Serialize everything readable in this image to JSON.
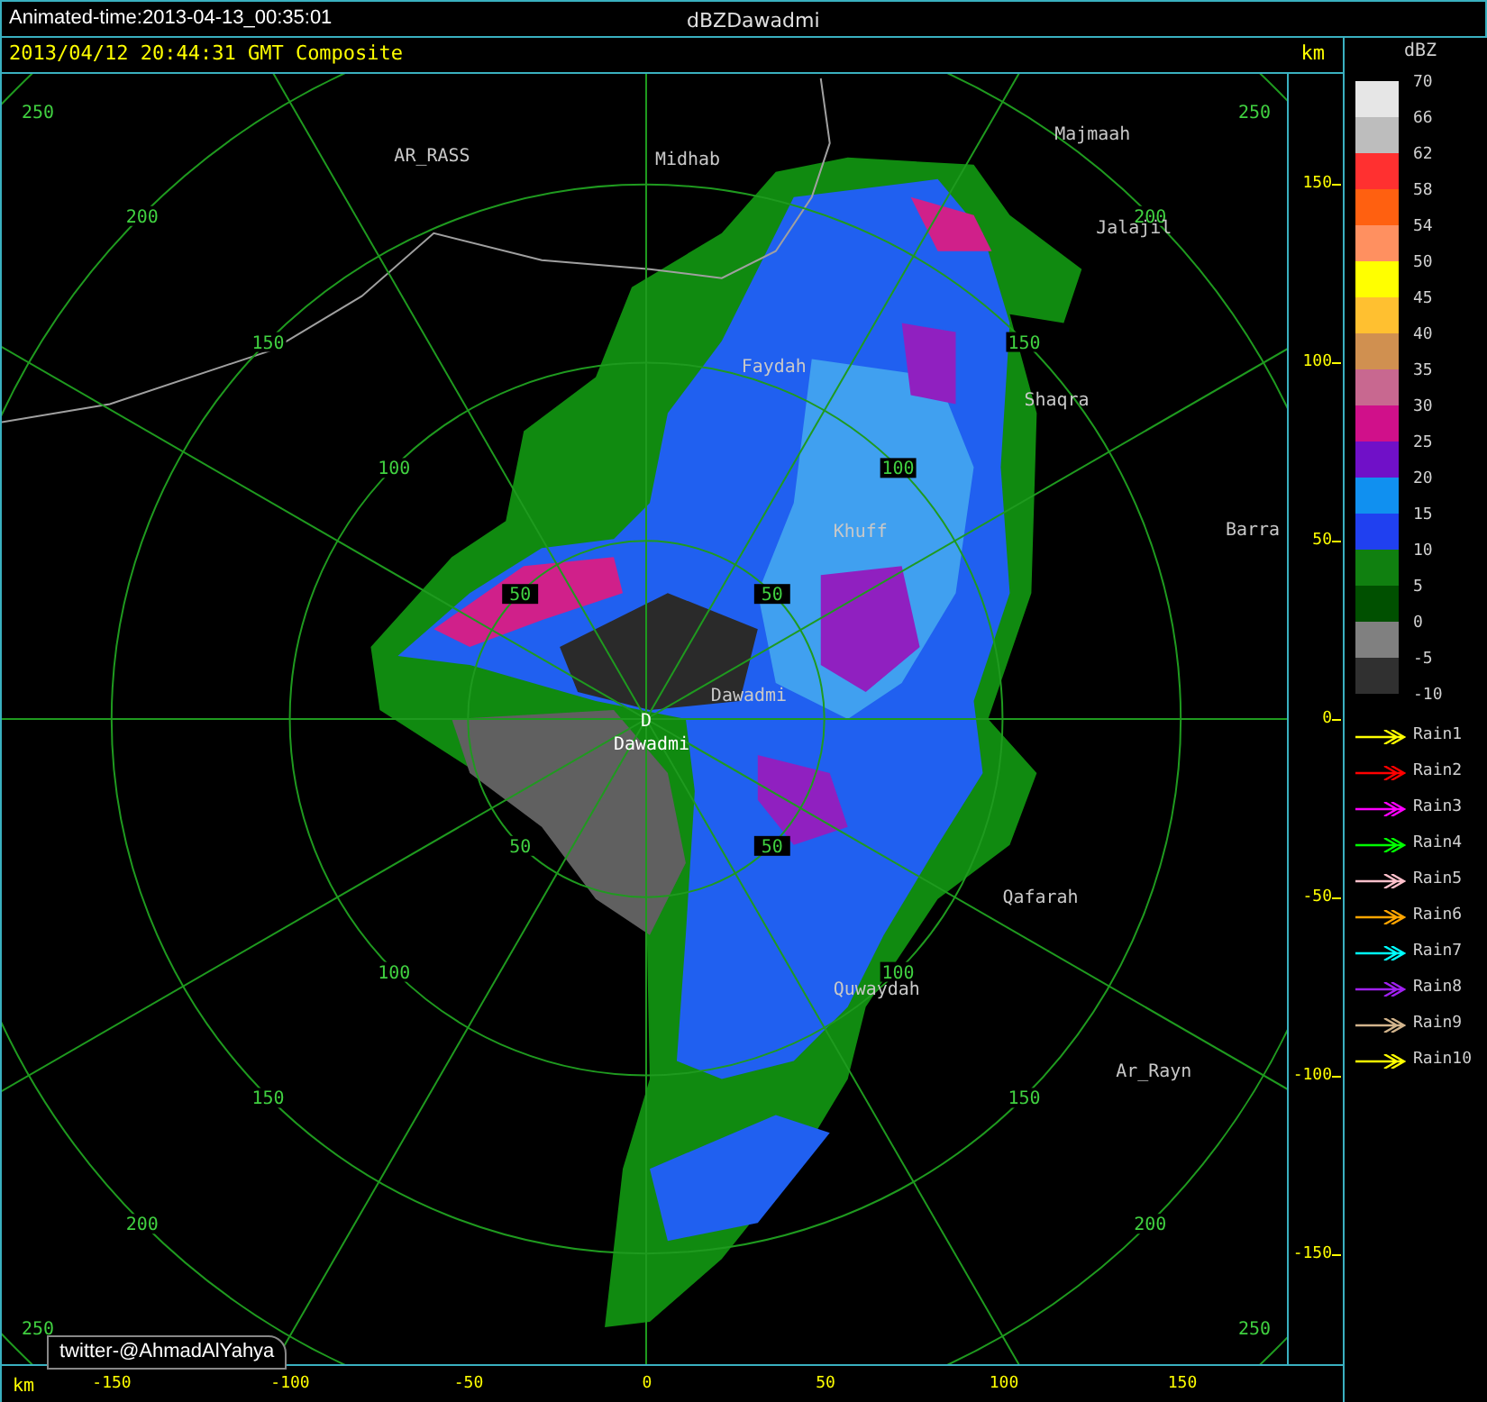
{
  "title_bar": {
    "animated_time": "Animated-time:2013-04-13_00:35:01",
    "product": "dBZDawadmi"
  },
  "header": {
    "timestamp": "2013/04/12 20:44:31 GMT Composite",
    "unit": "km"
  },
  "map": {
    "place_labels": [
      {
        "text": "AR_RASS",
        "kind": "city"
      },
      {
        "text": "Midhab",
        "kind": "city"
      },
      {
        "text": "Majmaah",
        "kind": "city"
      },
      {
        "text": "Jalajil",
        "kind": "city"
      },
      {
        "text": "Faydah",
        "kind": "city"
      },
      {
        "text": "Shaqra",
        "kind": "city"
      },
      {
        "text": "Khuff",
        "kind": "city"
      },
      {
        "text": "Barra",
        "kind": "city"
      },
      {
        "text": "Dawadmi",
        "kind": "city"
      },
      {
        "text": "D",
        "kind": "radar"
      },
      {
        "text": "Dawadmi",
        "kind": "radar"
      },
      {
        "text": "Qafarah",
        "kind": "city"
      },
      {
        "text": "Quwaydah",
        "kind": "city"
      },
      {
        "text": "Ar_Rayn",
        "kind": "city"
      }
    ],
    "ring_labels": [
      "50",
      "50",
      "50",
      "50",
      "100",
      "100",
      "100",
      "100",
      "150",
      "150",
      "150",
      "150",
      "200",
      "200",
      "200",
      "200",
      "250",
      "250",
      "250",
      "250"
    ],
    "credit": "twitter-@AhmadAlYahya"
  },
  "x_axis": {
    "unit": "km",
    "ticks": [
      "-150",
      "-100",
      "-50",
      "0",
      "50",
      "100",
      "150"
    ]
  },
  "y_axis": {
    "ticks": [
      "150",
      "100",
      "50",
      "0",
      "-50",
      "-100",
      "-150"
    ]
  },
  "legend": {
    "unit": "dBZ",
    "labels": [
      "70",
      "66",
      "62",
      "58",
      "54",
      "50",
      "45",
      "40",
      "35",
      "30",
      "25",
      "20",
      "15",
      "10",
      "5",
      "0",
      "-5",
      "-10"
    ],
    "swatches": [
      {
        "color": "#e6e6e6"
      },
      {
        "color": "#bdbdbd"
      },
      {
        "color": "#ff3030"
      },
      {
        "color": "#ff6010"
      },
      {
        "color": "#ff9060"
      },
      {
        "color": "#ffff00"
      },
      {
        "color": "#ffc030"
      },
      {
        "color": "#d09050"
      },
      {
        "color": "#c86890"
      },
      {
        "color": "#d0108a"
      },
      {
        "color": "#7010c8"
      },
      {
        "color": "#1090f0"
      },
      {
        "color": "#2040f0"
      },
      {
        "color": "#108010"
      },
      {
        "color": "#005000"
      },
      {
        "color": "#808080"
      },
      {
        "color": "#303030"
      }
    ]
  },
  "rain_legend": [
    {
      "label": "Rain1",
      "color": "#ffff00"
    },
    {
      "label": "Rain2",
      "color": "#ff0000"
    },
    {
      "label": "Rain3",
      "color": "#ff00ff"
    },
    {
      "label": "Rain4",
      "color": "#00ff00"
    },
    {
      "label": "Rain5",
      "color": "#ffc0cb"
    },
    {
      "label": "Rain6",
      "color": "#ffa500"
    },
    {
      "label": "Rain7",
      "color": "#00ffff"
    },
    {
      "label": "Rain8",
      "color": "#a020f0"
    },
    {
      "label": "Rain9",
      "color": "#d2b48c"
    },
    {
      "label": "Rain10",
      "color": "#ffff00"
    }
  ]
}
